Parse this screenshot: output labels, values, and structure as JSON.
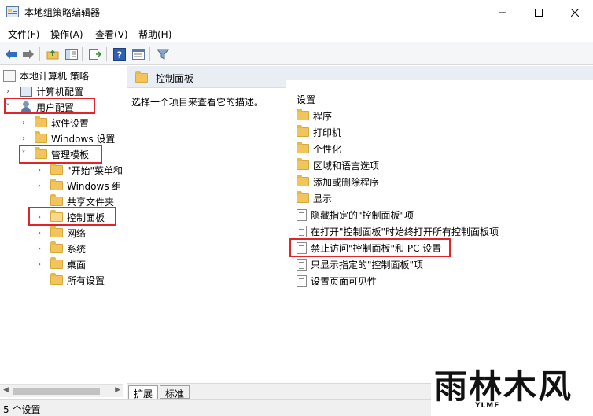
{
  "window": {
    "title": "本地组策略编辑器",
    "minimize_icon": "minimize-icon",
    "maximize_icon": "maximize-icon",
    "close_icon": "close-icon"
  },
  "menu": {
    "items": [
      "文件(F)",
      "操作(A)",
      "查看(V)",
      "帮助(H)"
    ]
  },
  "toolbar": {
    "icons": [
      "back-arrow-icon",
      "forward-arrow-icon",
      "up-folder-icon",
      "show-hide-tree-icon",
      "export-list-icon",
      "help-icon",
      "properties-icon",
      "filter-icon"
    ]
  },
  "tree": {
    "root": "本地计算机 策略",
    "computer_config": "计算机配置",
    "user_config": "用户配置",
    "software_settings": "软件设置",
    "windows_settings": "Windows 设置",
    "admin_templates": "管理模板",
    "start_menu": "\"开始\"菜单和",
    "windows_components": "Windows 组",
    "shared_folders": "共享文件夹",
    "control_panel": "控制面板",
    "network": "网络",
    "system": "系统",
    "desktop": "桌面",
    "all_settings": "所有设置"
  },
  "right": {
    "header_title": "控制面板",
    "description": "选择一个项目来查看它的描述。",
    "column_header": "设置",
    "folders": [
      "程序",
      "打印机",
      "个性化",
      "区域和语言选项",
      "添加或删除程序",
      "显示"
    ],
    "policies": [
      "隐藏指定的\"控制面板\"项",
      "在打开\"控制面板\"时始终打开所有控制面板项",
      "禁止访问\"控制面板\"和 PC 设置",
      "只显示指定的\"控制面板\"项",
      "设置页面可见性"
    ]
  },
  "tabs": {
    "extended": "扩展",
    "standard": "标准"
  },
  "status": {
    "text": "5 个设置"
  },
  "watermark": {
    "main": "雨林木风",
    "sub": "YLMF"
  },
  "colors": {
    "highlight": "#e0242c",
    "folder": "#f2c55c",
    "header_bg": "#e9eef5"
  }
}
